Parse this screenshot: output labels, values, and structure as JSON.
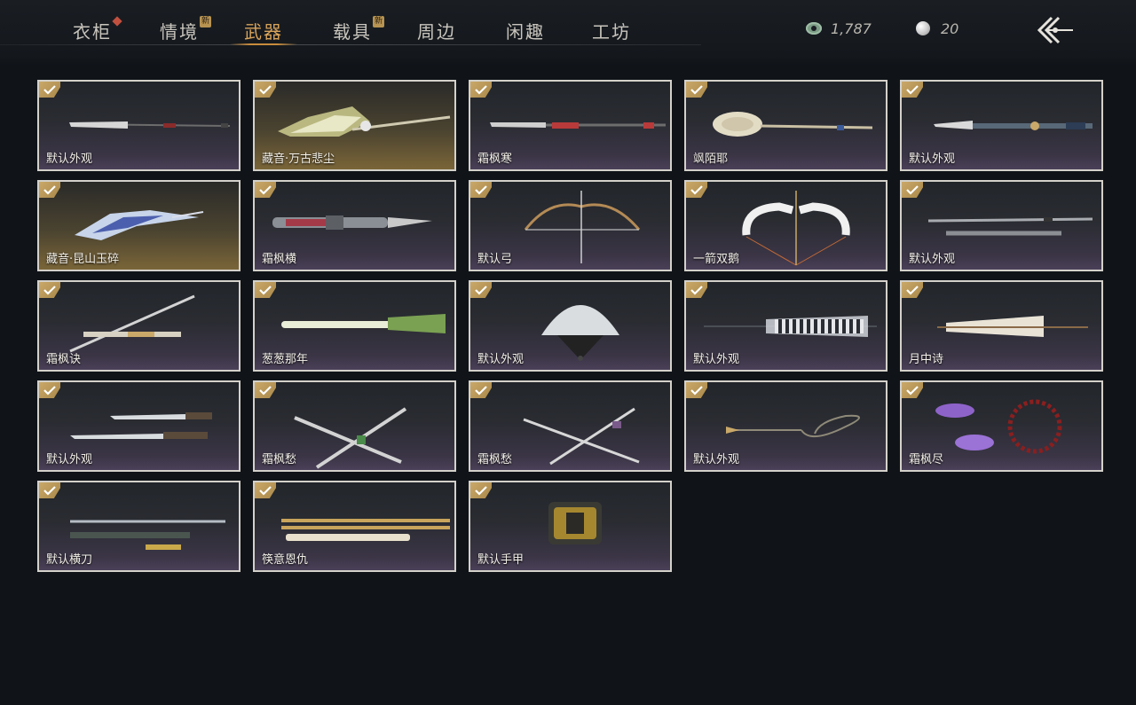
{
  "nav": {
    "tabs": [
      {
        "label": "衣柜",
        "badge": "dot"
      },
      {
        "label": "情境",
        "badge": "新"
      },
      {
        "label": "武器",
        "active": true
      },
      {
        "label": "载具",
        "badge": "新"
      },
      {
        "label": "周边"
      },
      {
        "label": "闲趣"
      },
      {
        "label": "工坊"
      }
    ]
  },
  "currency": {
    "jade": "1,787",
    "pearl": "20"
  },
  "icons": {
    "jade": "jade-coin-icon",
    "pearl": "pearl-icon",
    "back": "back-arrow-icon",
    "owned": "checkmark-icon"
  },
  "colors": {
    "accent": "#d8a35a",
    "check_gold": "#c9a869",
    "badge_red": "#c2503f"
  },
  "items": [
    {
      "name": "默认外观",
      "weapon": "spear"
    },
    {
      "name": "藏音·万古悲尘",
      "weapon": "glaive",
      "rarity": "gold"
    },
    {
      "name": "霜枫寒",
      "weapon": "spear-red"
    },
    {
      "name": "飒陌耶",
      "weapon": "spoon"
    },
    {
      "name": "默认外观",
      "weapon": "ornate-spear"
    },
    {
      "name": "藏音·昆山玉碎",
      "weapon": "crystal-blade",
      "rarity": "gold"
    },
    {
      "name": "霜枫横",
      "weapon": "dao"
    },
    {
      "name": "默认弓",
      "weapon": "bow"
    },
    {
      "name": "一箭双鹅",
      "weapon": "goose-bow"
    },
    {
      "name": "默认外观",
      "weapon": "twin-rods"
    },
    {
      "name": "霜枫诀",
      "weapon": "sword"
    },
    {
      "name": "葱葱那年",
      "weapon": "leek"
    },
    {
      "name": "默认外观",
      "weapon": "fan"
    },
    {
      "name": "默认外观",
      "weapon": "umbrella"
    },
    {
      "name": "月中诗",
      "weapon": "paper-umbrella"
    },
    {
      "name": "默认外观",
      "weapon": "twin-blades"
    },
    {
      "name": "霜枫愁",
      "weapon": "crossed-blades"
    },
    {
      "name": "霜枫愁",
      "weapon": "crossed-swords"
    },
    {
      "name": "默认外观",
      "weapon": "rope-dart"
    },
    {
      "name": "霜枫尽",
      "weapon": "meteor-hammer"
    },
    {
      "name": "默认横刀",
      "weapon": "hengdao"
    },
    {
      "name": "筷意恩仇",
      "weapon": "chopsticks"
    },
    {
      "name": "默认手甲",
      "weapon": "gauntlet"
    }
  ]
}
